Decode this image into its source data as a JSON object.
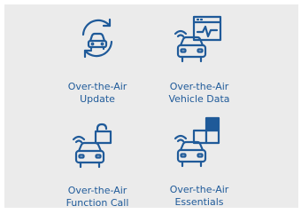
{
  "colors": {
    "accent": "#1f5a99",
    "panel": "#ebebeb"
  },
  "tiles": [
    {
      "icon": "refresh-car-icon",
      "line1": "Over-the-Air",
      "line2": "Update"
    },
    {
      "icon": "car-monitor-icon",
      "line1": "Over-the-Air",
      "line2": "Vehicle Data"
    },
    {
      "icon": "car-lock-icon",
      "line1": "Over-the-Air",
      "line2": "Function Call"
    },
    {
      "icon": "car-blocks-icon",
      "line1": "Over-the-Air",
      "line2": "Essentials"
    }
  ]
}
